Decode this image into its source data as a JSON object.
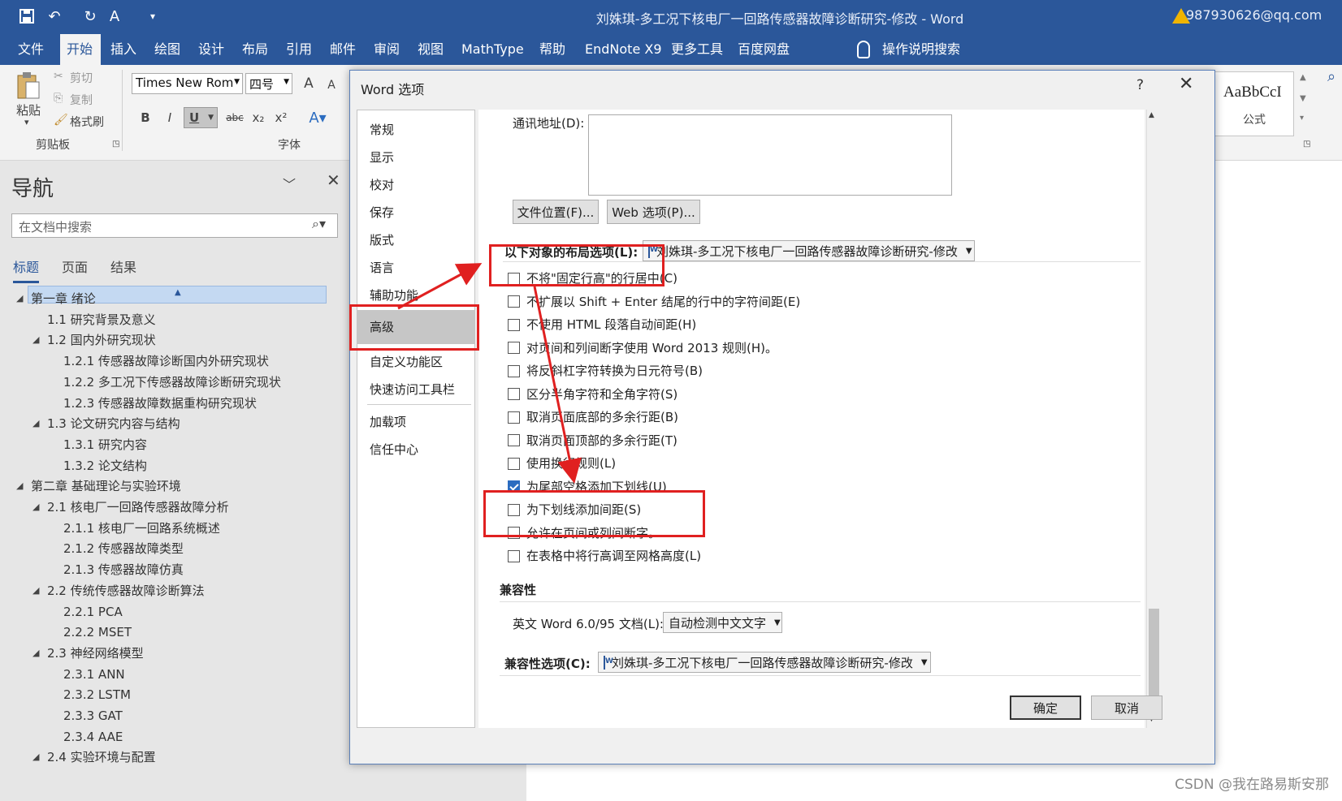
{
  "title_bar": {
    "document_title": "刘姝琪-多工况下核电厂一回路传感器故障诊断研究-修改  -  Word",
    "account": "987930626@qq.com",
    "icons": [
      "save-icon",
      "undo-icon",
      "redo-icon",
      "format-painter-icon",
      "customize-icon",
      "warning-icon"
    ]
  },
  "menu": [
    "文件",
    "开始",
    "插入",
    "绘图",
    "设计",
    "布局",
    "引用",
    "邮件",
    "审阅",
    "视图",
    "MathType",
    "帮助",
    "EndNote X9",
    "更多工具",
    "百度网盘",
    "操作说明搜索"
  ],
  "ribbon": {
    "paste": "粘贴",
    "cut": "剪切",
    "copy": "复制",
    "format_painter": "格式刷",
    "clipboard_group": "剪贴板",
    "font_name": "Times New Rom",
    "font_size": "四号",
    "font_group": "字体",
    "bold": "B",
    "italic": "I",
    "underline": "U",
    "strike": "abc",
    "subscript": "x₂",
    "superscript": "x²",
    "grow": "A",
    "shrink": "A",
    "style_preview": "AaBbCcI",
    "style_name": "公式"
  },
  "nav": {
    "title": "导航",
    "search_placeholder": "在文档中搜索",
    "tabs": [
      "标题",
      "页面",
      "结果"
    ],
    "tree": [
      {
        "level": 1,
        "text": "第一章 绪论",
        "toggle": "◢"
      },
      {
        "level": 2,
        "text": "1.1 研究背景及意义",
        "toggle": ""
      },
      {
        "level": 2,
        "text": "1.2 国内外研究现状",
        "toggle": "◢"
      },
      {
        "level": 3,
        "text": "1.2.1 传感器故障诊断国内外研究现状",
        "toggle": ""
      },
      {
        "level": 3,
        "text": "1.2.2 多工况下传感器故障诊断研究现状",
        "toggle": ""
      },
      {
        "level": 3,
        "text": "1.2.3 传感器故障数据重构研究现状",
        "toggle": ""
      },
      {
        "level": 2,
        "text": "1.3 论文研究内容与结构",
        "toggle": "◢"
      },
      {
        "level": 3,
        "text": "1.3.1 研究内容",
        "toggle": ""
      },
      {
        "level": 3,
        "text": "1.3.2 论文结构",
        "toggle": ""
      },
      {
        "level": 1,
        "text": "第二章 基础理论与实验环境",
        "toggle": "◢"
      },
      {
        "level": 2,
        "text": "2.1 核电厂一回路传感器故障分析",
        "toggle": "◢"
      },
      {
        "level": 3,
        "text": "2.1.1 核电厂一回路系统概述",
        "toggle": ""
      },
      {
        "level": 3,
        "text": "2.1.2 传感器故障类型",
        "toggle": ""
      },
      {
        "level": 3,
        "text": "2.1.3 传感器故障仿真",
        "toggle": ""
      },
      {
        "level": 2,
        "text": "2.2 传统传感器故障诊断算法",
        "toggle": "◢"
      },
      {
        "level": 3,
        "text": "2.2.1 PCA",
        "toggle": ""
      },
      {
        "level": 3,
        "text": "2.2.2 MSET",
        "toggle": ""
      },
      {
        "level": 2,
        "text": "2.3 神经网络模型",
        "toggle": "◢"
      },
      {
        "level": 3,
        "text": "2.3.1 ANN",
        "toggle": ""
      },
      {
        "level": 3,
        "text": "2.3.2 LSTM",
        "toggle": ""
      },
      {
        "level": 3,
        "text": "2.3.3 GAT",
        "toggle": ""
      },
      {
        "level": 3,
        "text": "2.3.4 AAE",
        "toggle": ""
      },
      {
        "level": 2,
        "text": "2.4 实验环境与配置",
        "toggle": "◢"
      }
    ]
  },
  "dialog": {
    "title": "Word 选项",
    "help": "?",
    "close": "✕",
    "categories": [
      "常规",
      "显示",
      "校对",
      "保存",
      "版式",
      "语言",
      "辅助功能",
      "高级",
      "自定义功能区",
      "快速访问工具栏",
      "加载项",
      "信任中心"
    ],
    "active_category": "高级",
    "mail_address_label": "通讯地址(D):",
    "file_locations_button": "文件位置(F)...",
    "web_options_button": "Web 选项(P)...",
    "layout_options_label": "以下对象的布局选项(L):",
    "layout_options_doc": "刘姝琪-多工况下核电厂一回路传感器故障诊断研究-修改",
    "options": [
      {
        "label": "不将\"固定行高\"的行居中(C)",
        "checked": false
      },
      {
        "label": "不扩展以 Shift + Enter 结尾的行中的字符间距(E)",
        "checked": false
      },
      {
        "label": "不使用 HTML 段落自动间距(H)",
        "checked": false
      },
      {
        "label": "对页间和列间断字使用 Word 2013 规则(H)。",
        "checked": false
      },
      {
        "label": "将反斜杠字符转换为日元符号(B)",
        "checked": false
      },
      {
        "label": "区分半角字符和全角字符(S)",
        "checked": false
      },
      {
        "label": "取消页面底部的多余行距(B)",
        "checked": false
      },
      {
        "label": "取消页面顶部的多余行距(T)",
        "checked": false
      },
      {
        "label": "使用换行规则(L)",
        "checked": false
      },
      {
        "label": "为尾部空格添加下划线(U)",
        "checked": true
      },
      {
        "label": "为下划线添加间距(S)",
        "checked": false
      },
      {
        "label": "允许在页间或列间断字。",
        "checked": false
      },
      {
        "label": "在表格中将行高调至网格高度(L)",
        "checked": false
      }
    ],
    "compat_header": "兼容性",
    "word6_label": "英文 Word 6.0/95 文档(L):",
    "word6_value": "自动检测中文文字",
    "compat_options_label": "兼容性选项(C):",
    "compat_options_doc": "刘姝琪-多工况下核电厂一回路传感器故障诊断研究-修改",
    "ok": "确定",
    "cancel": "取消"
  },
  "watermark": "CSDN @我在路易斯安那"
}
